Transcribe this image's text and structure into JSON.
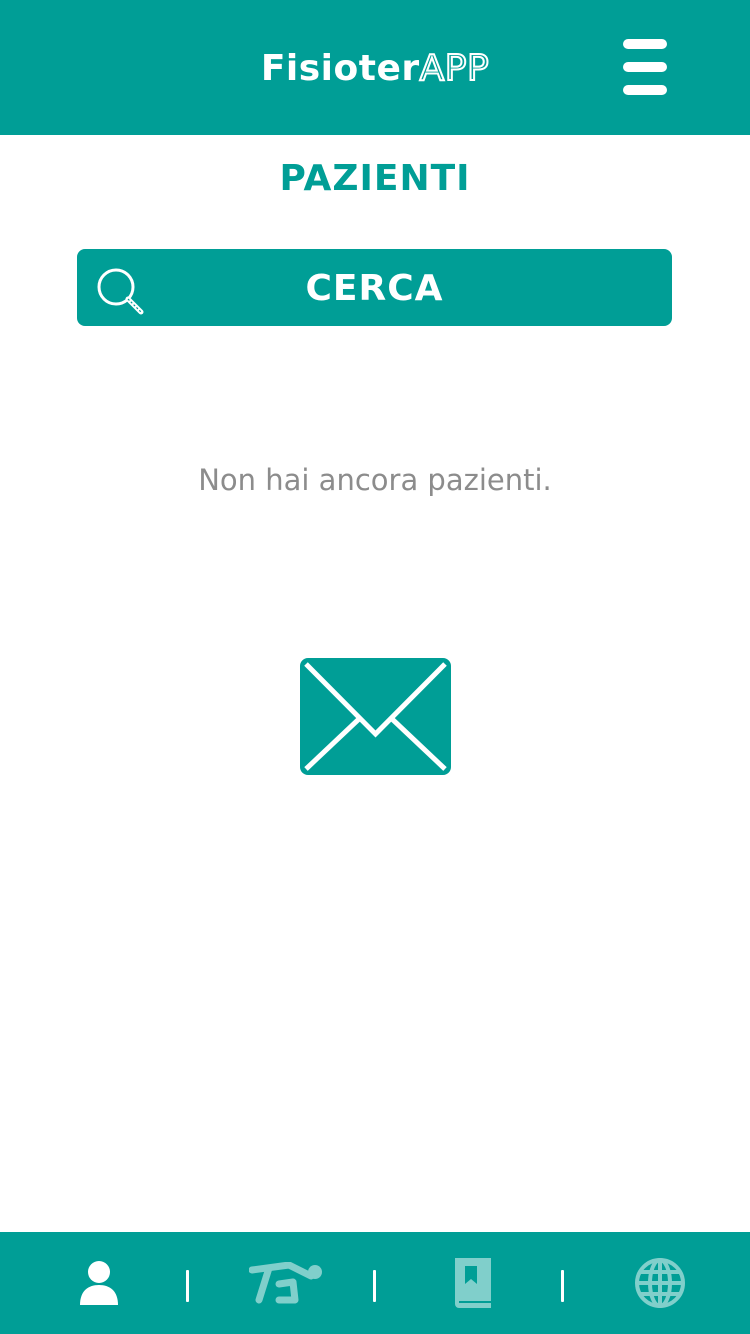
{
  "header": {
    "logo_bold": "Fisioter",
    "logo_outline": "APP",
    "menu_icon": "hamburger-menu-icon"
  },
  "page": {
    "title": "PAZIENTI"
  },
  "search": {
    "label": "CERCA",
    "icon": "search-icon"
  },
  "empty_state": {
    "message": "Non hai ancora pazienti.",
    "icon": "mail-icon"
  },
  "bottom_nav": {
    "items": [
      {
        "icon": "person-icon",
        "active": true
      },
      {
        "icon": "exercise-icon",
        "active": false
      },
      {
        "icon": "book-icon",
        "active": false
      },
      {
        "icon": "globe-icon",
        "active": false
      }
    ]
  },
  "colors": {
    "brand": "#009E96",
    "white": "#FFFFFF",
    "inactive_icon": "#80CFCB",
    "muted_text": "#8C8C8C"
  }
}
